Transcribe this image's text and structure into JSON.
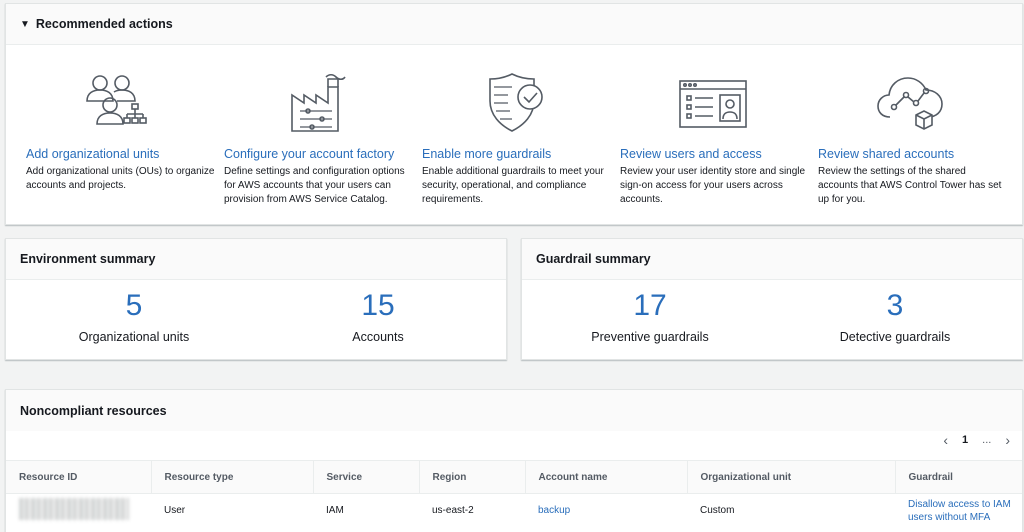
{
  "recommended": {
    "header": "Recommended actions",
    "actions": [
      {
        "icon": "users-org-icon",
        "title": "Add organizational units",
        "desc": "Add organizational units (OUs) to organize accounts and projects."
      },
      {
        "icon": "factory-icon",
        "title": "Configure your account factory",
        "desc": "Define settings and configuration options for AWS accounts that your users can provision from AWS Service Catalog."
      },
      {
        "icon": "shield-check-icon",
        "title": "Enable more guardrails",
        "desc": "Enable additional guardrails to meet your security, operational, and compliance requirements."
      },
      {
        "icon": "identity-card-icon",
        "title": "Review users and access",
        "desc": "Review your user identity store and single sign-on access for your users across accounts."
      },
      {
        "icon": "cloud-shared-icon",
        "title": "Review shared accounts",
        "desc": "Review the settings of the shared accounts that AWS Control Tower has set up for you."
      }
    ]
  },
  "environment": {
    "header": "Environment summary",
    "stats": [
      {
        "value": "5",
        "label": "Organizational units"
      },
      {
        "value": "15",
        "label": "Accounts"
      }
    ]
  },
  "guardrail": {
    "header": "Guardrail summary",
    "stats": [
      {
        "value": "17",
        "label": "Preventive guardrails"
      },
      {
        "value": "3",
        "label": "Detective guardrails"
      }
    ]
  },
  "noncompliant": {
    "header": "Noncompliant resources",
    "pagination": {
      "current": "1",
      "ellipsis": "..."
    },
    "columns": [
      "Resource ID",
      "Resource type",
      "Service",
      "Region",
      "Account name",
      "Organizational unit",
      "Guardrail"
    ],
    "rows": [
      {
        "resource_type": "User",
        "service": "IAM",
        "region": "us-east-2",
        "account_name": "backup",
        "ou": "Custom",
        "guardrail": "Disallow access to IAM users without MFA"
      }
    ]
  },
  "colors": {
    "link": "#2a6ebb",
    "text": "#16191f",
    "background": "#f2f3f3"
  }
}
